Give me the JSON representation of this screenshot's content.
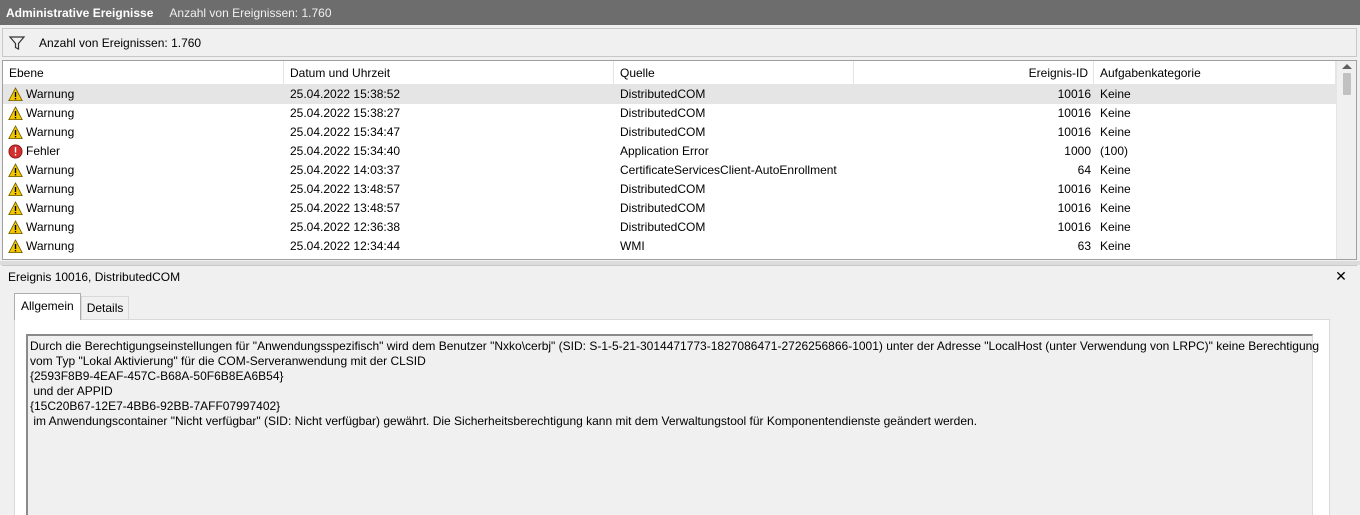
{
  "titlebar": {
    "title": "Administrative Ereignisse",
    "count": "Anzahl von Ereignissen: 1.760"
  },
  "filterbar": {
    "icon": "filter-icon",
    "count": "Anzahl von Ereignissen: 1.760"
  },
  "list": {
    "columns": {
      "level": "Ebene",
      "date": "Datum und Uhrzeit",
      "source": "Quelle",
      "id": "Ereignis-ID",
      "category": "Aufgabenkategorie"
    },
    "rows": [
      {
        "level": "Warnung",
        "icon": "warning-icon",
        "date": "25.04.2022 15:38:52",
        "source": "DistributedCOM",
        "id": "10016",
        "category": "Keine"
      },
      {
        "level": "Warnung",
        "icon": "warning-icon",
        "date": "25.04.2022 15:38:27",
        "source": "DistributedCOM",
        "id": "10016",
        "category": "Keine"
      },
      {
        "level": "Warnung",
        "icon": "warning-icon",
        "date": "25.04.2022 15:34:47",
        "source": "DistributedCOM",
        "id": "10016",
        "category": "Keine"
      },
      {
        "level": "Fehler",
        "icon": "error-icon",
        "date": "25.04.2022 15:34:40",
        "source": "Application Error",
        "id": "1000",
        "category": "(100)"
      },
      {
        "level": "Warnung",
        "icon": "warning-icon",
        "date": "25.04.2022 14:03:37",
        "source": "CertificateServicesClient-AutoEnrollment",
        "id": "64",
        "category": "Keine"
      },
      {
        "level": "Warnung",
        "icon": "warning-icon",
        "date": "25.04.2022 13:48:57",
        "source": "DistributedCOM",
        "id": "10016",
        "category": "Keine"
      },
      {
        "level": "Warnung",
        "icon": "warning-icon",
        "date": "25.04.2022 13:48:57",
        "source": "DistributedCOM",
        "id": "10016",
        "category": "Keine"
      },
      {
        "level": "Warnung",
        "icon": "warning-icon",
        "date": "25.04.2022 12:36:38",
        "source": "DistributedCOM",
        "id": "10016",
        "category": "Keine"
      },
      {
        "level": "Warnung",
        "icon": "warning-icon",
        "date": "25.04.2022 12:34:44",
        "source": "WMI",
        "id": "63",
        "category": "Keine"
      }
    ]
  },
  "detail": {
    "title": "Ereignis 10016, DistributedCOM",
    "tabs": {
      "general": "Allgemein",
      "details": "Details"
    },
    "description_lines": [
      "Durch die Berechtigungseinstellungen für \"Anwendungsspezifisch\" wird dem Benutzer \"Nxko\\cerbj\" (SID: S-1-5-21-3014471773-1827086471-2726256866-1001) unter der Adresse \"LocalHost (unter Verwendung von LRPC)\" keine Berechtigung",
      "vom Typ \"Lokal Aktivierung\" für die COM-Serveranwendung mit der CLSID",
      "{2593F8B9-4EAF-457C-B68A-50F6B8EA6B54}",
      " und der APPID",
      "{15C20B67-12E7-4BB6-92BB-7AFF07997402}",
      " im Anwendungscontainer \"Nicht verfügbar\" (SID: Nicht verfügbar) gewährt. Die Sicherheitsberechtigung kann mit dem Verwaltungstool für Komponentendienste geändert werden."
    ]
  },
  "colors": {
    "titlebar_bg": "#6d6d6d",
    "warning_yellow": "#f2c600",
    "error_red": "#d32f2f",
    "selected_row": "#e5e5e5"
  }
}
